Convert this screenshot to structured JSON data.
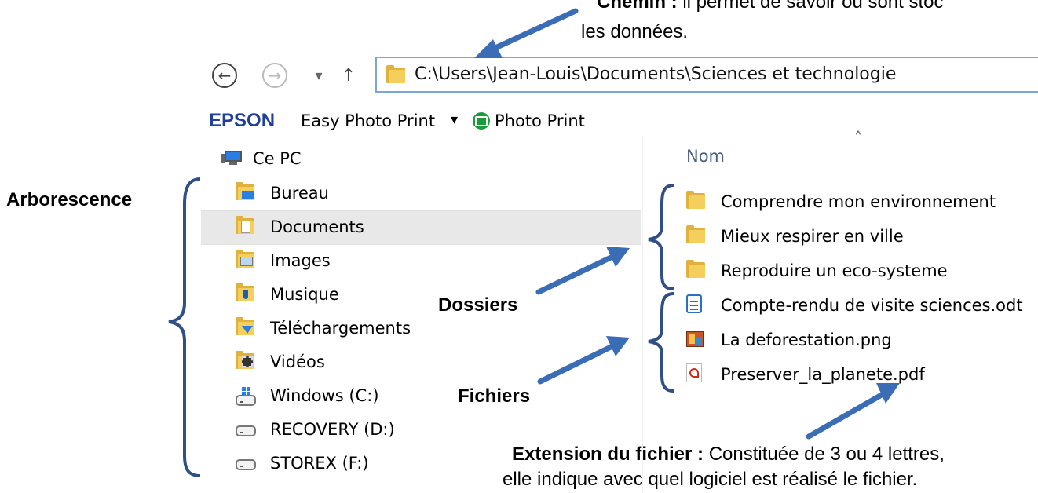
{
  "annotations": {
    "chemin_title": "Chemin :",
    "chemin_text": " il permet de savoir où sont stoc",
    "chemin_line2": "les données.",
    "arborescence": "Arborescence",
    "dossiers": "Dossiers",
    "fichiers": "Fichiers",
    "extension_title": "Extension du fichier :",
    "extension_text": " Constituée de 3 ou 4 lettres,",
    "extension_line2": "elle indique avec quel logiciel est réalisé le fichier."
  },
  "navigation": {
    "back_glyph": "←",
    "forward_glyph": "→",
    "recent_glyph": "▾",
    "up_glyph": "↑",
    "address": "C:\\Users\\Jean-Louis\\Documents\\Sciences et technologie"
  },
  "toolbar": {
    "epson": "EPSON",
    "easy_photo_print": "Easy Photo Print",
    "dropdown_glyph": "▾",
    "photo_print": "Photo Print"
  },
  "tree": {
    "root": "Ce PC",
    "items": [
      {
        "label": "Bureau",
        "icon": "desktop-folder-icon"
      },
      {
        "label": "Documents",
        "icon": "documents-folder-icon"
      },
      {
        "label": "Images",
        "icon": "images-folder-icon"
      },
      {
        "label": "Musique",
        "icon": "music-folder-icon"
      },
      {
        "label": "Téléchargements",
        "icon": "downloads-folder-icon"
      },
      {
        "label": "Vidéos",
        "icon": "videos-folder-icon"
      },
      {
        "label": "Windows (C:)",
        "icon": "windows-drive-icon"
      },
      {
        "label": "RECOVERY (D:)",
        "icon": "drive-icon"
      },
      {
        "label": "STOREX (F:)",
        "icon": "drive-icon"
      }
    ]
  },
  "files": {
    "column_header": "Nom",
    "sort_glyph": "˄",
    "items": [
      {
        "label": "Comprendre mon environnement",
        "icon": "folder-icon"
      },
      {
        "label": "Mieux respirer en ville",
        "icon": "folder-icon"
      },
      {
        "label": "Reproduire un eco-systeme",
        "icon": "folder-icon"
      },
      {
        "label": "Compte-rendu de visite sciences.odt",
        "icon": "document-file-icon"
      },
      {
        "label": "La deforestation.png",
        "icon": "image-file-icon"
      },
      {
        "label": "Preserver_la_planete.pdf",
        "icon": "pdf-file-icon"
      }
    ]
  },
  "colors": {
    "arrow": "#3a6db5",
    "brace": "#2f4f86",
    "selection": "#e8e8e8",
    "address_border": "#7aa7d8"
  }
}
